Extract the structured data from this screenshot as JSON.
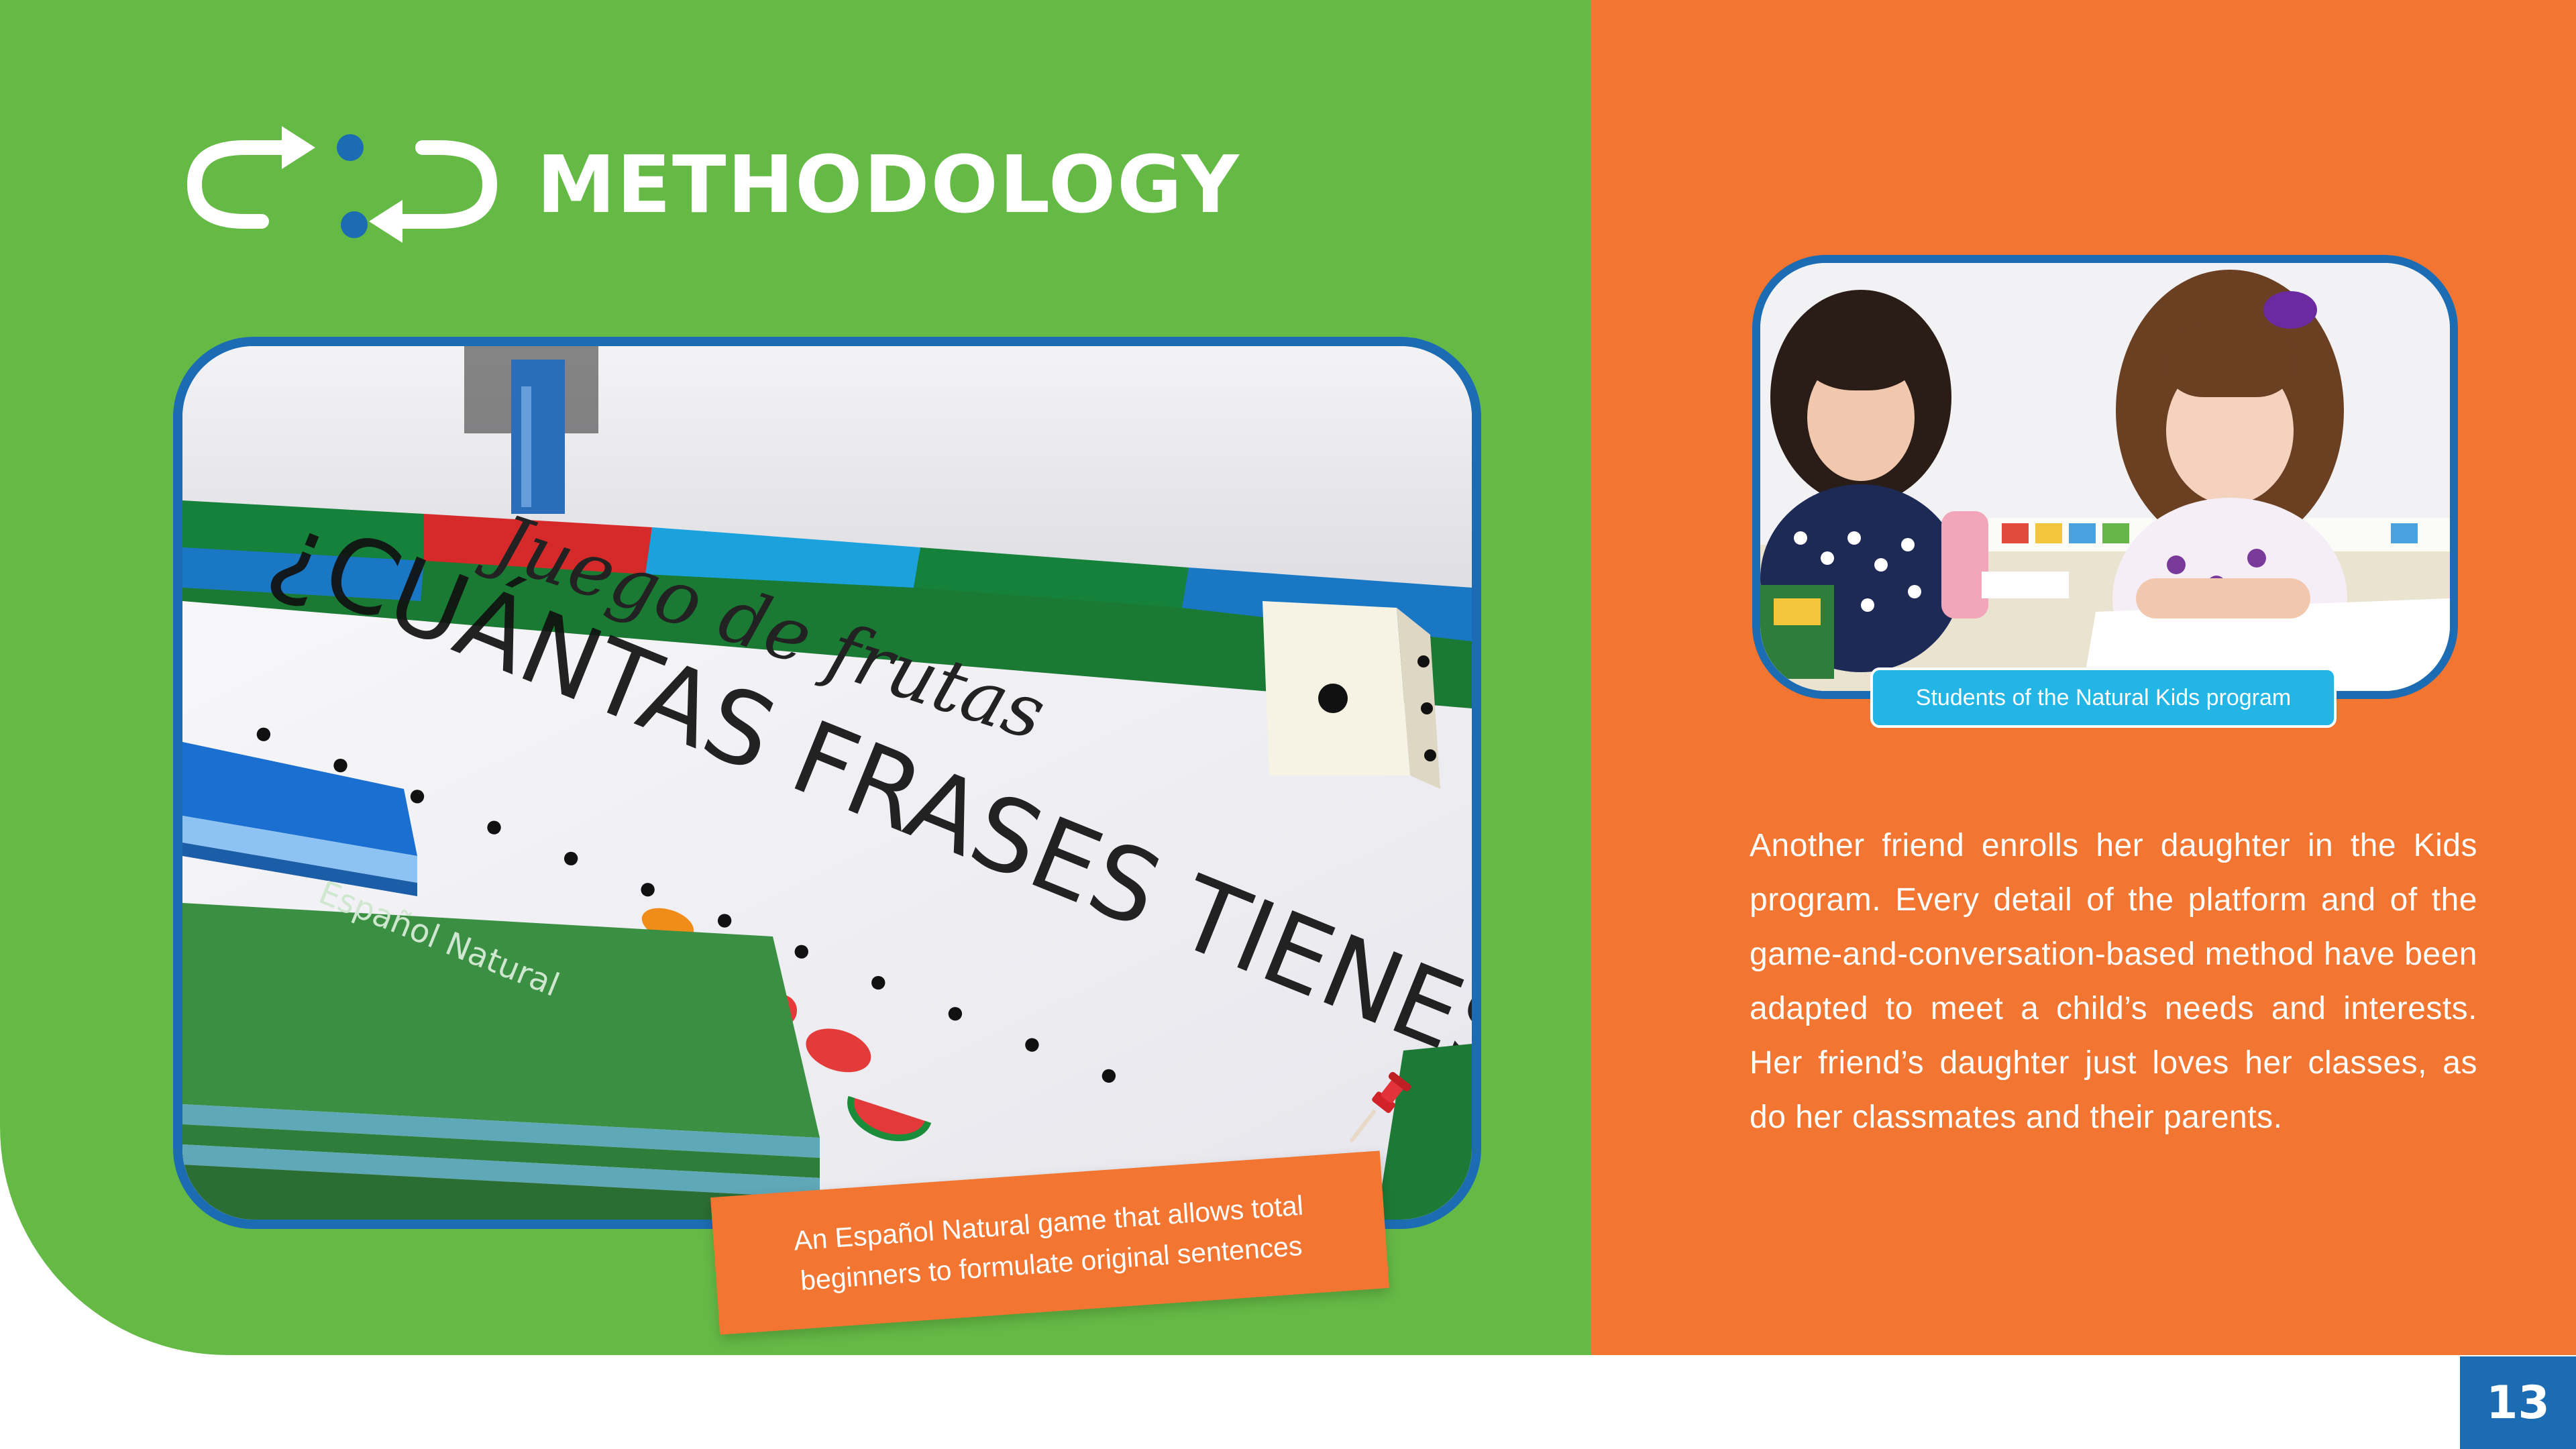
{
  "page": {
    "title": "METHODOLOGY",
    "page_number": "13",
    "colors": {
      "green": "#65BA46",
      "orange": "#F27631",
      "blue": "#1C6CB3",
      "cyan": "#22B5E5",
      "white": "#FFFFFF"
    },
    "title_icon": "cycle-arrows-icon"
  },
  "main_photo": {
    "caption": "An Español Natural game that allows total beginners to formulate original sentences",
    "pin_icon": "pushpin-icon"
  },
  "kids_photo": {
    "caption": "Students of the Natural Kids program"
  },
  "body": {
    "paragraph": "Another friend enrolls her daughter in the Kids program. Every detail of the platform and of the game-and-conversation-based method have been adapted to meet a child’s needs and interests. Her friend’s daughter just loves her classes, as do her classmates and their parents."
  }
}
